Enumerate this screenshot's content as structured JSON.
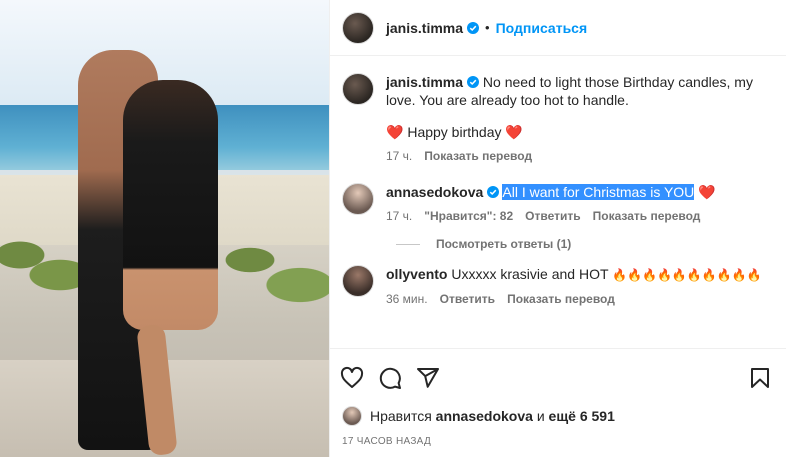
{
  "header": {
    "username": "janis.timma",
    "separator": "•",
    "follow_label": "Подписаться"
  },
  "caption": {
    "username": "janis.timma",
    "text": "No need to light those Birthday candles, my love. You are already too hot to handle.",
    "line2": "Happy birthday",
    "time": "17 ч.",
    "translate": "Показать перевод"
  },
  "comments": [
    {
      "username": "annasedokova",
      "text": "All I want for Christmas is YOU",
      "time": "17 ч.",
      "likes": "\"Нравится\": 82",
      "reply": "Ответить",
      "translate": "Показать перевод",
      "view_replies": "Посмотреть ответы (1)"
    },
    {
      "username": "ollyvento",
      "text": "Uxxxxx krasivie and HOT",
      "emojis": "🔥🔥🔥🔥🔥🔥🔥🔥🔥🔥",
      "time": "36 мин.",
      "reply": "Ответить",
      "translate": "Показать перевод"
    }
  ],
  "likes": {
    "prefix": "Нравится",
    "user": "annasedokova",
    "mid": "и",
    "count": "ещё 6 591"
  },
  "timestamp": "17 часов назад",
  "icons": [
    "heart-icon",
    "comment-icon",
    "share-icon",
    "bookmark-icon",
    "verified-icon"
  ],
  "colors": {
    "accent": "#0095f6",
    "heart": "#ed4956",
    "selection": "#3390ff"
  }
}
